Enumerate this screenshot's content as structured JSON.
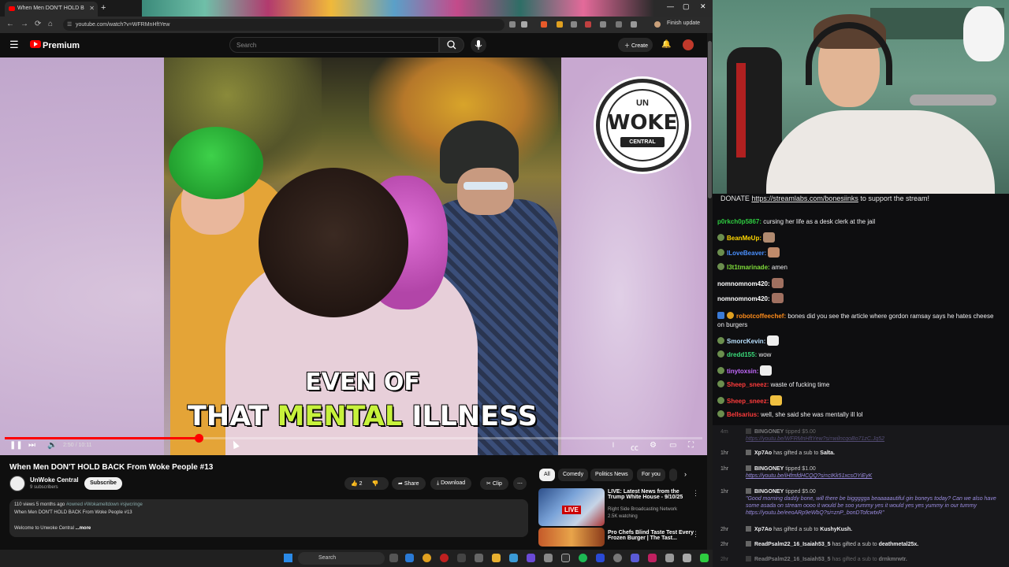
{
  "browser": {
    "tab_title": "When Men DON'T HOLD B",
    "url": "youtube.com/watch?v=WFRMnHftYew",
    "finish_update": "Finish update"
  },
  "youtube": {
    "brand": "Premium",
    "search_placeholder": "Search",
    "create_label": "Create"
  },
  "video": {
    "caption_line1": "EVEN OF",
    "caption_line2_a": "THAT ",
    "caption_line2_hl": "MENTAL",
    "caption_line2_b": " ILLNESS",
    "logo_top": "UN",
    "logo_main": "WOKE",
    "logo_bottom": "CENTRAL",
    "time_readout": "2:50 / 10:11",
    "progress": 0.278,
    "title": "When Men DON'T HOLD BACK From Woke People #13"
  },
  "channel": {
    "name": "UnWoke Central",
    "subs": "9 subscribers",
    "subscribe_label": "Subscribe"
  },
  "actions": {
    "likes": "2",
    "share": "Share",
    "download": "Download",
    "clip": "Clip"
  },
  "description": {
    "stats": "110 views  5 months ago",
    "tags": "#owned #Wokameltdown #sjwcringe",
    "line2": "When Men DON'T HOLD BACK From Woke People #13",
    "line3": "Welcome to Unwoke Central",
    "more": "...more"
  },
  "chips": [
    "All",
    "Comedy",
    "Politics News",
    "For you"
  ],
  "recommendations": [
    {
      "title": "LIVE: Latest News from the Trump White House - 9/10/25",
      "channel": "Right Side Broadcasting Network",
      "meta": "2.5K watching",
      "live_label": "LIVE"
    },
    {
      "title": "Pro Chefs Blind Taste Test Every Frozen Burger | The Tast..."
    }
  ],
  "taskbar": {
    "search": "Search"
  },
  "chat": {
    "donate_prefix": "DONATE ",
    "donate_link": "https://streamlabs.com/bonesiinks",
    "donate_suffix": " to support the stream!",
    "messages": [
      {
        "user": "p0rkch0p5867:",
        "color": "#2ecc40",
        "text": "cursing her life as a desk clerk at the jail"
      },
      {
        "user": "BeanMeUp:",
        "color": "#ffd700",
        "text": ""
      },
      {
        "user": "lLoveBeaver:",
        "color": "#4a90ff",
        "text": ""
      },
      {
        "user": "l3t1tmarinade:",
        "color": "#7fdc3a",
        "text": "amen"
      },
      {
        "user": "nomnomnom420:",
        "color": "#ffffff",
        "text": ""
      },
      {
        "user": "nomnomnom420:",
        "color": "#ffffff",
        "text": ""
      },
      {
        "user": "robotcoffeechef:",
        "color": "#ff8c1a",
        "text": "bones did you see the article where gordon ramsay says he hates cheese on burgers"
      },
      {
        "user": "SmorcKevin:",
        "color": "#b8e0ff",
        "text": ""
      },
      {
        "user": "dredd155:",
        "color": "#3adc7a",
        "text": "wow"
      },
      {
        "user": "tinytoxsin:",
        "color": "#c46aff",
        "text": ""
      },
      {
        "user": "Sheep_sneez:",
        "color": "#ff3b3b",
        "text": "waste of fucking time"
      },
      {
        "user": "Sheep_sneez:",
        "color": "#ff3b3b",
        "text": ""
      },
      {
        "user": "Bellsarius:",
        "color": "#ff3b3b",
        "text": "well, she said she was mentally ill lol"
      }
    ],
    "alerts": [
      {
        "ago": "4m",
        "who": "BINGONEY",
        "action": "tipped $5.00",
        "detail": "https://youtu.be/WFRMnHftYew?si=wilncqoBo71zC.Jq52",
        "detail_type": "link",
        "dim": true
      },
      {
        "ago": "1hr",
        "who": "Xp7Ao",
        "action": "has gifted a sub to",
        "target": "Salta",
        "dim": false
      },
      {
        "ago": "1hr",
        "who": "BINGONEY",
        "action": "tipped $1.00",
        "detail": "https://youtu.be/iHfmfdHCQQ?si=cIKk51xcsOYiEyK",
        "detail_type": "link",
        "dim": false
      },
      {
        "ago": "1hr",
        "who": "BINGONEY",
        "action": "tipped $5.00",
        "detail": "\"Good morning daddy bone, will there be biggggga beaaaaautiful gin boneys today? Can we also have some asada on stream oooo it would be soo yummy yes it would yes yes yummy in our tummy https://youtu.be/eeoARp9eWbQ?si=znP_bonDTofcwtxR\"",
        "detail_type": "quote",
        "dim": false
      },
      {
        "ago": "2hr",
        "who": "Xp7Ao",
        "action": "has gifted a sub to",
        "target": "KushyKush",
        "dim": false
      },
      {
        "ago": "2hr",
        "who": "ReadPsalm22_16_Isaiah53_5",
        "action": "has gifted a sub to",
        "target": "deathmetal25x",
        "dim": false
      },
      {
        "ago": "2hr",
        "who": "ReadPsalm22_16_Isaiah53_5",
        "action": "has gifted a sub to",
        "target": "drnkmrwtr",
        "dim": true
      }
    ]
  },
  "colors": {
    "yt_red": "#ff0000",
    "caption_highlight": "#c7f23c",
    "chat_bg": "#0e0e10"
  }
}
